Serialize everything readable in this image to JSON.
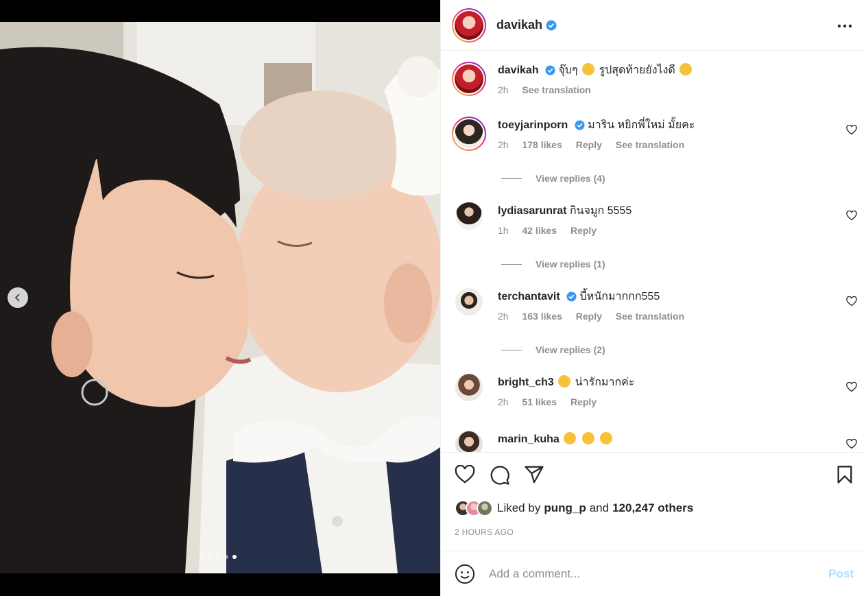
{
  "post": {
    "author": "davikah",
    "caption": "จุ๊บๆ",
    "caption_rest": "รูปสุดท้ายยังไงดี",
    "caption_time": "2h",
    "see_translation": "See translation",
    "more_icon": "more-horizontal-icon"
  },
  "carousel": {
    "total": 5,
    "active_index": 4
  },
  "comments": [
    {
      "user": "toeyjarinporn",
      "verified": true,
      "text": "มาริน หยิกพี่ใหม่ มั้ยคะ",
      "time": "2h",
      "likes": "178 likes",
      "reply": "Reply",
      "translate": "See translation",
      "replies": "View replies (4)"
    },
    {
      "user": "lydiasarunrat",
      "verified": false,
      "text": "กินจมูก 5555",
      "time": "1h",
      "likes": "42 likes",
      "reply": "Reply",
      "replies": "View replies (1)"
    },
    {
      "user": "terchantavit",
      "verified": true,
      "text": "บี้หนักมากกก555",
      "time": "2h",
      "likes": "163 likes",
      "reply": "Reply",
      "translate": "See translation",
      "replies": "View replies (2)"
    },
    {
      "user": "bright_ch3",
      "verified": false,
      "text": "น่ารักมากค่ะ",
      "time": "2h",
      "likes": "51 likes",
      "reply": "Reply"
    },
    {
      "user": "marin_kuha",
      "verified": false,
      "text": ""
    }
  ],
  "likes": {
    "prefix": "Liked by",
    "user": "pung_p",
    "and": "and",
    "others": "120,247 others",
    "timestamp": "2 HOURS AGO"
  },
  "composer": {
    "placeholder": "Add a comment...",
    "post_label": "Post"
  },
  "colors": {
    "verified": "#3897f0",
    "muted": "#8e8e8e",
    "post_disabled": "#b2dffc"
  }
}
